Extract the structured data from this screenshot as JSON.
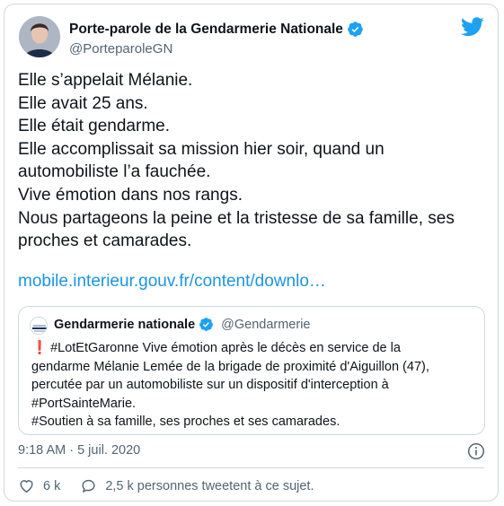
{
  "author": {
    "name": "Porte-parole de la Gendarmerie Nationale",
    "handle": "@PorteparoleGN"
  },
  "tweet": {
    "lines": [
      "Elle s’appelait Mélanie.",
      "Elle avait 25 ans.",
      "Elle était gendarme.",
      "Elle accomplissait sa mission hier soir, quand un",
      "automobiliste l’a fauchée.",
      "Vive émotion dans nos rangs.",
      "Nous partageons la peine et la tristesse de sa famille, ses",
      "proches et camarades."
    ],
    "link": "mobile.interieur.gouv.fr/content/downlo…"
  },
  "quote": {
    "name": "Gendarmerie nationale",
    "handle": "@Gendarmerie",
    "exclamation": "❗",
    "lines": [
      "#LotEtGaronne Vive émotion après le décès en service de la",
      "gendarme Mélanie Lemée de la brigade de proximité d'Aiguillon (47),",
      "percutée par un automobiliste sur un dispositif d'interception à",
      "#PortSainteMarie.",
      "#Soutien à sa famille, ses proches et ses camarades."
    ]
  },
  "meta": {
    "time": "9:18 AM",
    "separator": " · ",
    "date": "5 juil. 2020"
  },
  "actions": {
    "likes": "6 k",
    "replies_text": "2,5 k personnes tweetent à ce sujet."
  },
  "colors": {
    "link": "#1b95e0",
    "verified": "#1da1f2",
    "muted": "#536471",
    "border": "#cfd9de"
  },
  "icons": [
    "verified-badge-icon",
    "twitter-bird-icon",
    "info-icon",
    "heart-icon",
    "speech-bubble-icon",
    "gendarmerie-logo-icon"
  ]
}
